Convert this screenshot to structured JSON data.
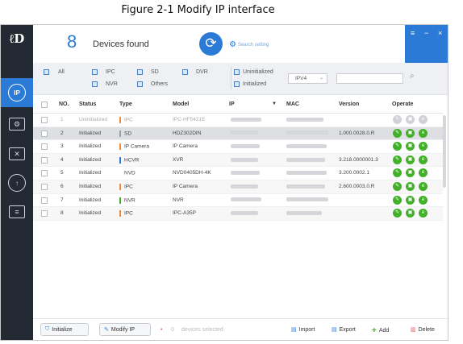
{
  "caption": "Figure 2-1 Modify IP interface",
  "header": {
    "device_count": "8",
    "devices_found_label": "Devices found",
    "search_setting_label": "Search setting"
  },
  "window_controls": {
    "menu": "≡",
    "minimize": "−",
    "close": "×"
  },
  "filters": {
    "all": "All",
    "ipc": "IPC",
    "sd": "SD",
    "dvr": "DVR",
    "nvr": "NVR",
    "others": "Others",
    "uninitialized": "Uninitialized",
    "initialized": "Initialized",
    "ip_version": "IPV4",
    "search_placeholder": ""
  },
  "table": {
    "headers": {
      "no": "NO.",
      "status": "Status",
      "type": "Type",
      "model": "Model",
      "ip": "IP",
      "mac": "MAC",
      "version": "Version",
      "operate": "Operate"
    },
    "rows": [
      {
        "no": "1",
        "status": "Uninitialized",
        "type": "IPC",
        "type_color": "#f08a3c",
        "model": "IPC-HF5421E",
        "version": ""
      },
      {
        "no": "2",
        "status": "Initialized",
        "type": "SD",
        "type_color": "#9a9ea5",
        "model": "HDZ302DIN",
        "version": "1.000.0028.0.R"
      },
      {
        "no": "3",
        "status": "Initialized",
        "type": "IP Camera",
        "type_color": "#f08a3c",
        "model": "IP Camera",
        "version": ""
      },
      {
        "no": "4",
        "status": "Initialized",
        "type": "HCVR",
        "type_color": "#2b7bd6",
        "model": "XVR",
        "version": "3.218.0000001.3"
      },
      {
        "no": "5",
        "status": "Initialized",
        "type": "NVD",
        "type_color": "#ffffff",
        "model": "NVD0405DH-4K",
        "version": "3.200.0002.1"
      },
      {
        "no": "6",
        "status": "Initialized",
        "type": "IPC",
        "type_color": "#f08a3c",
        "model": "IP Camera",
        "version": "2.600.0003.0.R"
      },
      {
        "no": "7",
        "status": "Initialized",
        "type": "NVR",
        "type_color": "#43b02a",
        "model": "NVR",
        "version": ""
      },
      {
        "no": "8",
        "status": "Initialized",
        "type": "IPC",
        "type_color": "#f08a3c",
        "model": "IPC-A35P",
        "version": ""
      }
    ]
  },
  "footer": {
    "initialize": "Initialize",
    "modify_ip": "Modify IP",
    "selected_count": "0",
    "selected_label": "devices selected",
    "import": "Import",
    "export": "Export",
    "add": "Add",
    "delete": "Delete"
  },
  "colors": {
    "accent": "#2b7bd6",
    "sidebar": "#242a33",
    "ok": "#43b02a"
  }
}
